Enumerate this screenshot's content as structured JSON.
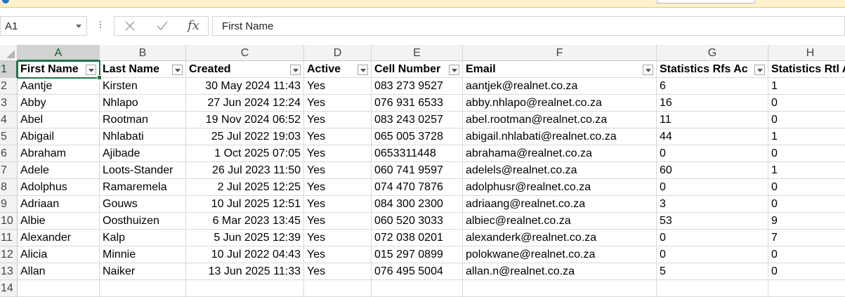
{
  "formula_bar": {
    "name_box": "A1",
    "function_symbol": "fx",
    "formula_value": "First Name"
  },
  "columns": [
    "A",
    "B",
    "C",
    "D",
    "E",
    "F",
    "G",
    "H"
  ],
  "headers": [
    "First Name",
    "Last Name",
    "Created",
    "Active",
    "Cell Number",
    "Email",
    "Statistics Rfs Ac",
    "Statistics Rtl A"
  ],
  "row_numbers": [
    "1",
    "2",
    "3",
    "4",
    "5",
    "6",
    "7",
    "8",
    "9",
    "10",
    "11",
    "12",
    "13",
    "14"
  ],
  "rows": [
    [
      "Aantje",
      "Kirsten",
      "30 May 2024 11:43",
      "Yes",
      "083 273 9527",
      "aantjek@realnet.co.za",
      "6",
      "1"
    ],
    [
      "Abby",
      "Nhlapo",
      "27 Jun 2024 12:24",
      "Yes",
      "076 931 6533",
      "abby.nhlapo@realnet.co.za",
      "16",
      "0"
    ],
    [
      "Abel",
      "Rootman",
      "19 Nov 2024 06:52",
      "Yes",
      "083 243 0257",
      "abel.rootman@realnet.co.za",
      "11",
      "0"
    ],
    [
      "Abigail",
      "Nhlabati",
      "25 Jul 2022 19:03",
      "Yes",
      "065 005 3728",
      "abigail.nhlabati@realnet.co.za",
      "44",
      "1"
    ],
    [
      "Abraham",
      "Ajibade",
      "1 Oct 2025 07:05",
      "Yes",
      "0653311448",
      "abrahama@realnet.co.za",
      "0",
      "0"
    ],
    [
      "Adele",
      "Loots-Stander",
      "26 Jul 2023 11:50",
      "Yes",
      "060 741 9597",
      "adelels@realnet.co.za",
      "60",
      "1"
    ],
    [
      "Adolphus",
      "Ramaremela",
      "2 Jul 2025 12:25",
      "Yes",
      "074 470 7876",
      "adolphusr@realnet.co.za",
      "0",
      "0"
    ],
    [
      "Adriaan",
      "Gouws",
      "10 Jul 2025 12:51",
      "Yes",
      "084 300 2300",
      "adriaang@realnet.co.za",
      "3",
      "0"
    ],
    [
      "Albie",
      "Oosthuizen",
      "6 Mar 2023 13:45",
      "Yes",
      "060 520 3033",
      "albiec@realnet.co.za",
      "53",
      "9"
    ],
    [
      "Alexander",
      "Kalp",
      "5 Jun 2025 12:39",
      "Yes",
      "072 038 0201",
      "alexanderk@realnet.co.za",
      "0",
      "7"
    ],
    [
      "Alicia",
      "Minnie",
      "10 Jul 2022 04:43",
      "Yes",
      "015 297 0899",
      "polokwane@realnet.co.za",
      "0",
      "0"
    ],
    [
      "Allan",
      "Naiker",
      "13 Jun 2025 11:33",
      "Yes",
      "076 495 5004",
      "allan.n@realnet.co.za",
      "5",
      "0"
    ],
    [
      "",
      "",
      "",
      "",
      "",
      "",
      "",
      ""
    ]
  ],
  "colors": {
    "accent_green": "#217346",
    "header_bg": "#f3f3f3",
    "gridline": "#d9d9d9",
    "message_bar": "#fff2cc"
  }
}
